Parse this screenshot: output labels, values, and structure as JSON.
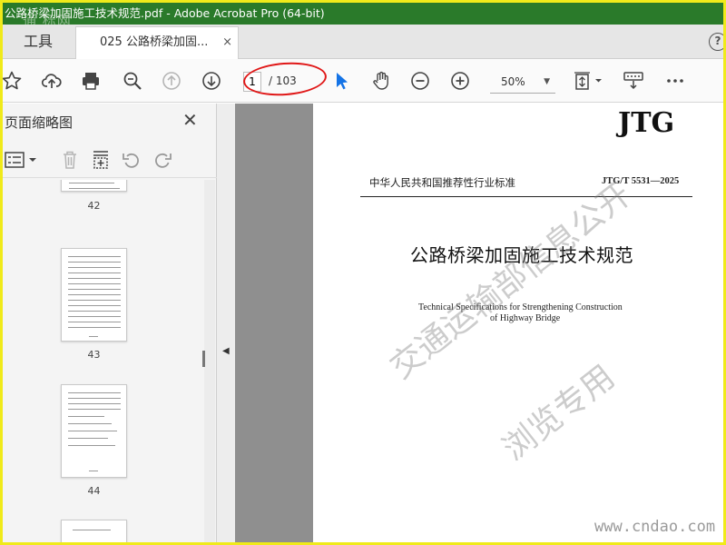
{
  "window": {
    "title": "公路桥梁加固施工技术规范.pdf - Adobe Acrobat Pro (64-bit)",
    "site_mark": "通 标网"
  },
  "tabs": {
    "tools_label": "工具",
    "doc_label": "025 公路桥梁加固...",
    "close_glyph": "×",
    "help_glyph": "?"
  },
  "toolbar": {
    "icons": [
      "star-icon",
      "cloud-upload-icon",
      "print-icon",
      "zoom-search-icon",
      "page-up-icon",
      "page-down-icon",
      "select-cursor-icon",
      "hand-icon",
      "zoom-out-icon",
      "zoom-in-icon",
      "fit-page-icon",
      "comment-keyboard-icon",
      "more-icon"
    ],
    "page_current": "1",
    "page_total": "/ 103",
    "zoom_value": "50%",
    "zoom_caret": "▼",
    "colors": {
      "selected_tool": "#1473e6",
      "annotation_ellipse": "#e01818"
    }
  },
  "sidebar": {
    "title": "页面缩略图",
    "close_glyph": "✕",
    "tool_icons": [
      "thumbnail-options-icon",
      "delete-icon",
      "insert-page-icon",
      "rotate-left-icon",
      "rotate-right-icon"
    ],
    "thumbnails": [
      {
        "label": "42"
      },
      {
        "label": "43"
      },
      {
        "label": "44"
      },
      {
        "label": ""
      }
    ]
  },
  "divider": {
    "caret": "◀"
  },
  "document": {
    "logo": "JTG",
    "standard_cn": "中华人民共和国推荐性行业标准",
    "standard_code": "JTG/T 5531—2025",
    "title_cn": "公路桥梁加固施工技术规范",
    "title_en_line1": "Technical Specifications for Strengthening Construction",
    "title_en_line2": "of Highway Bridge",
    "watermark_line1": "交通运输部信息公开",
    "watermark_line2": "浏览专用",
    "site_watermark": "www.cndao.com"
  }
}
